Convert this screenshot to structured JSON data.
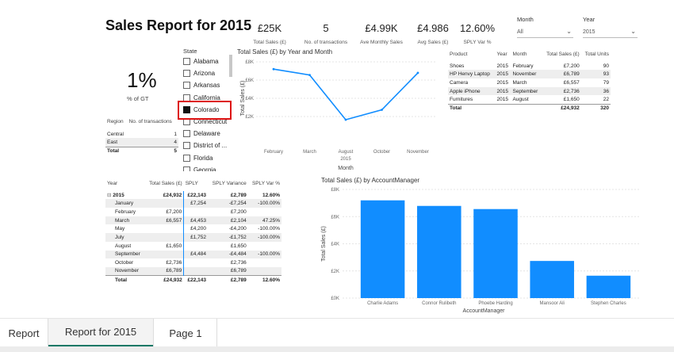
{
  "report": {
    "title": "Sales Report for 2015"
  },
  "kpis": [
    {
      "value": "£25K",
      "label": "Total Sales (£)"
    },
    {
      "value": "5",
      "label": "No. of transactions"
    },
    {
      "value": "£4.99K",
      "label": "Ave Monthly Sales"
    },
    {
      "value": "£4.986",
      "label": "Avg Sales (£)"
    },
    {
      "value": "12.60%",
      "label": "SPLY Var %"
    }
  ],
  "month_slicer": {
    "label": "Month",
    "value": "All"
  },
  "year_slicer": {
    "label": "Year",
    "value": "2015"
  },
  "pct_card": {
    "value": "1%",
    "label": "% of GT"
  },
  "state_slicer": {
    "label": "State",
    "items": [
      {
        "name": "Alabama",
        "checked": false
      },
      {
        "name": "Arizona",
        "checked": false
      },
      {
        "name": "Arkansas",
        "checked": false
      },
      {
        "name": "California",
        "checked": false
      },
      {
        "name": "Colorado",
        "checked": true
      },
      {
        "name": "Connecticut",
        "checked": false
      },
      {
        "name": "Delaware",
        "checked": false
      },
      {
        "name": "District of ...",
        "checked": false
      },
      {
        "name": "Florida",
        "checked": false
      },
      {
        "name": "Georgia",
        "checked": false
      }
    ]
  },
  "region_table": {
    "headers": [
      "Region",
      "No. of transactions"
    ],
    "rows": [
      [
        "Central",
        "1"
      ],
      [
        "East",
        "4"
      ]
    ],
    "total": [
      "Total",
      "5"
    ]
  },
  "product_table": {
    "headers": [
      "Product",
      "Year",
      "Month",
      "Total Sales (£)",
      "Total Units"
    ],
    "rows": [
      [
        "Shoes",
        "2015",
        "February",
        "£7,200",
        "90"
      ],
      [
        "HP Henvy Laptop",
        "2015",
        "November",
        "£6,789",
        "93"
      ],
      [
        "Camera",
        "2015",
        "March",
        "£6,557",
        "79"
      ],
      [
        "Apple iPhone",
        "2015",
        "September",
        "£2,736",
        "36"
      ],
      [
        "Furnitures",
        "2015",
        "August",
        "£1,650",
        "22"
      ]
    ],
    "total": [
      "Total",
      "",
      "",
      "£24,932",
      "320"
    ]
  },
  "matrix_table": {
    "headers": [
      "Year",
      "Total Sales (£)",
      "SPLY",
      "SPLY Variance",
      "SPLY Var %"
    ],
    "group": [
      "2015",
      "£24,932",
      "£22,143",
      "£2,789",
      "12.60%"
    ],
    "group_toggle": "⊟",
    "rows": [
      [
        "January",
        "",
        "£7,254",
        "-£7,254",
        "-100.00%"
      ],
      [
        "February",
        "£7,200",
        "",
        "£7,200",
        ""
      ],
      [
        "March",
        "£6,557",
        "£4,453",
        "£2,104",
        "47.25%"
      ],
      [
        "May",
        "",
        "£4,200",
        "-£4,200",
        "-100.00%"
      ],
      [
        "July",
        "",
        "£1,752",
        "-£1,752",
        "-100.00%"
      ],
      [
        "August",
        "£1,650",
        "",
        "£1,650",
        ""
      ],
      [
        "September",
        "",
        "£4,484",
        "-£4,484",
        "-100.00%"
      ],
      [
        "October",
        "£2,736",
        "",
        "£2,736",
        ""
      ],
      [
        "November",
        "£6,789",
        "",
        "£6,789",
        ""
      ]
    ],
    "total": [
      "Total",
      "£24,932",
      "£22,143",
      "£2,789",
      "12.60%"
    ]
  },
  "tabs": [
    {
      "label": "Report",
      "active": false
    },
    {
      "label": "Report for 2015",
      "active": true
    },
    {
      "label": "Page 1",
      "active": false
    }
  ],
  "chart_data": [
    {
      "type": "line",
      "title": "Total Sales (£) by Year and Month",
      "xlabel": "Month",
      "ylabel": "Total Sales (£)",
      "year_label": "2015",
      "categories": [
        "February",
        "March",
        "August",
        "October",
        "November"
      ],
      "values": [
        7200,
        6557,
        1650,
        2736,
        6789
      ],
      "ylim": [
        0,
        8000
      ],
      "yticks": [
        2000,
        4000,
        6000,
        8000
      ],
      "ytick_labels": [
        "£2K",
        "£4K",
        "£6K",
        "£8K"
      ],
      "color": "#118dff"
    },
    {
      "type": "bar",
      "title": "Total Sales (£) by AccountManager",
      "xlabel": "AccountManager",
      "ylabel": "Total Sales (£)",
      "categories": [
        "Charlie Adams",
        "Connor Rulibeth",
        "Phoebe Harding",
        "Mansoor Ali",
        "Stephen Charles"
      ],
      "values": [
        7200,
        6789,
        6557,
        2736,
        1650
      ],
      "ylim": [
        0,
        8000
      ],
      "yticks": [
        0,
        2000,
        4000,
        6000,
        8000
      ],
      "ytick_labels": [
        "£0K",
        "£2K",
        "£4K",
        "£6K",
        "£8K"
      ],
      "color": "#118dff"
    }
  ]
}
